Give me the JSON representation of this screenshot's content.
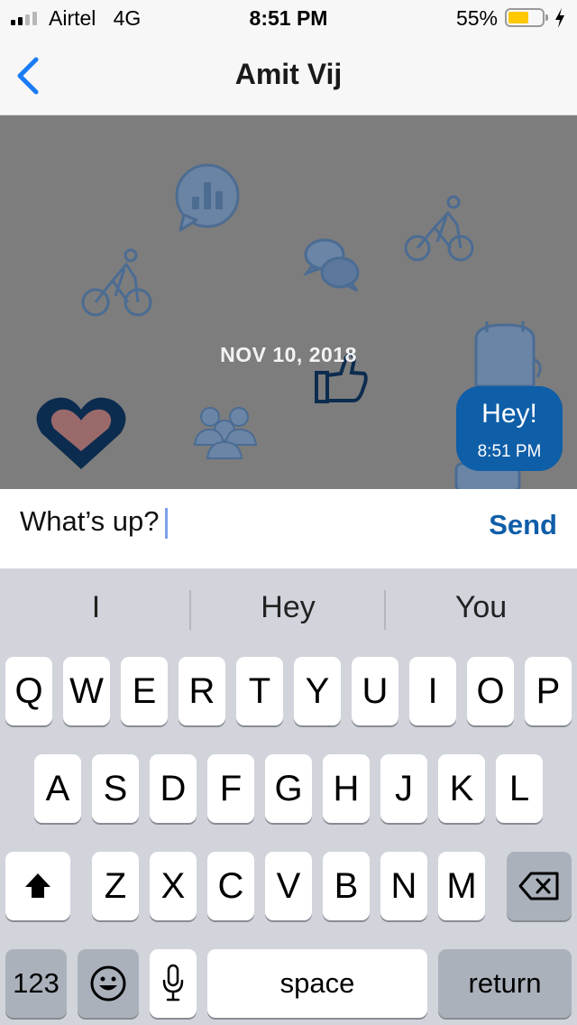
{
  "status_bar": {
    "carrier": "Airtel",
    "network": "4G",
    "time": "8:51 PM",
    "battery": "55%"
  },
  "nav": {
    "title": "Amit Vij",
    "back_icon": "chevron-left-icon"
  },
  "chat": {
    "date": "NOV 10, 2018",
    "messages": [
      {
        "text": "Hey!",
        "time": "8:51 PM",
        "outgoing": true
      }
    ]
  },
  "composer": {
    "value": "What’s up?",
    "send_label": "Send"
  },
  "keyboard": {
    "suggestions": [
      "I",
      "Hey",
      "You"
    ],
    "row1": [
      "Q",
      "W",
      "E",
      "R",
      "T",
      "Y",
      "U",
      "I",
      "O",
      "P"
    ],
    "row2": [
      "A",
      "S",
      "D",
      "F",
      "G",
      "H",
      "J",
      "K",
      "L"
    ],
    "row3": [
      "Z",
      "X",
      "C",
      "V",
      "B",
      "N",
      "M"
    ],
    "numbers_label": "123",
    "space_label": "space",
    "return_label": "return"
  },
  "colors": {
    "accent": "#0f5ea8",
    "chat_background": "#7d7d7d",
    "battery": "#ffc800"
  }
}
